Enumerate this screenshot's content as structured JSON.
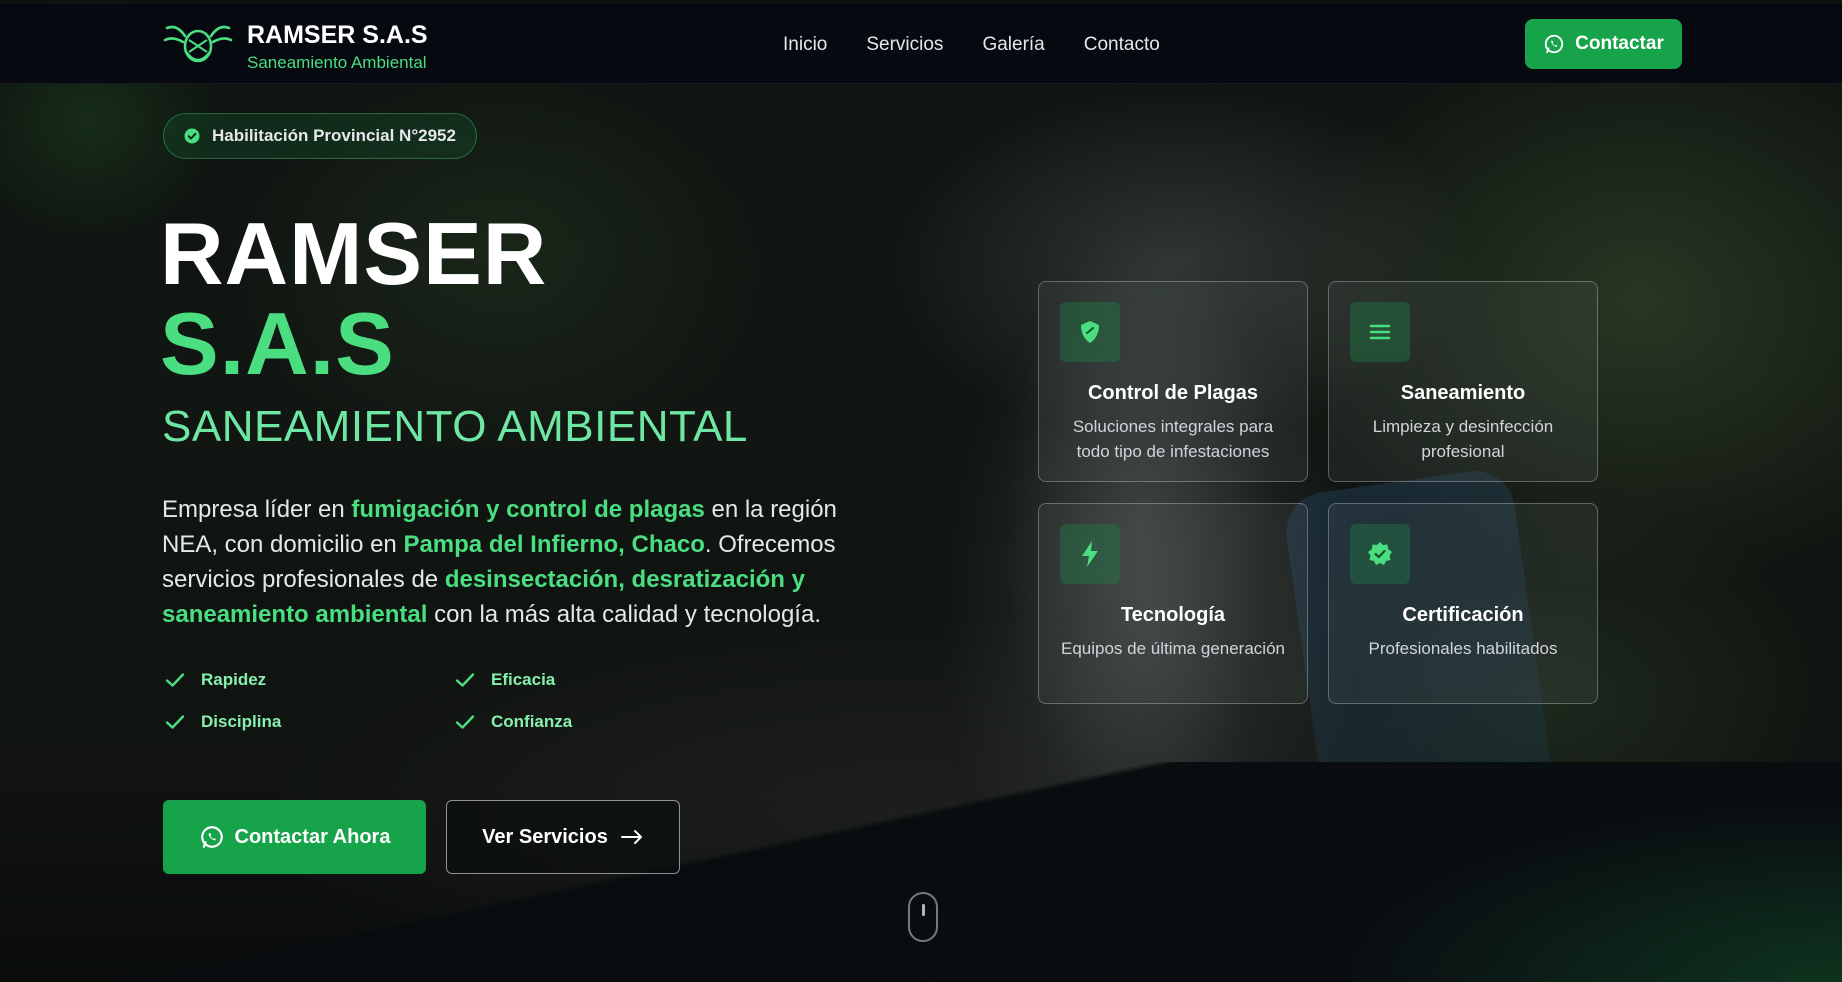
{
  "nav": {
    "brand_name": "RAMSER S.A.S",
    "brand_sub": "Saneamiento Ambiental",
    "links": [
      "Inicio",
      "Servicios",
      "Galería",
      "Contacto"
    ],
    "cta_label": "Contactar",
    "cta_icon": "whatsapp-icon"
  },
  "hero": {
    "badge": "Habilitación Provincial N°2952",
    "title_line1": "RAMSER",
    "title_line2": "S.A.S",
    "subtitle": "SANEAMIENTO AMBIENTAL",
    "desc": {
      "p1": "Empresa líder en ",
      "h1": "fumigación y control de plagas",
      "p2": " en la región NEA, con domicilio en ",
      "h2": "Pampa del Infierno, Chaco",
      "p3": ". Ofrecemos servicios profesionales de ",
      "h3": "desinsectación, desratización y saneamiento ambiental",
      "p4": " con la más alta calidad y tecnología."
    },
    "features": [
      "Rapidez",
      "Eficacia",
      "Disciplina",
      "Confianza"
    ],
    "primary_button": "Contactar Ahora",
    "secondary_button": "Ver Servicios"
  },
  "cards": [
    {
      "title": "Control de Plagas",
      "desc": "Soluciones integrales para todo tipo de infestaciones",
      "icon": "shield-check-icon"
    },
    {
      "title": "Saneamiento",
      "desc": "Limpieza y desinfección profesional",
      "icon": "menu-lines-icon"
    },
    {
      "title": "Tecnología",
      "desc": "Equipos de última generación",
      "icon": "lightning-icon"
    },
    {
      "title": "Certificación",
      "desc": "Profesionales habilitados",
      "icon": "badge-check-icon"
    }
  ],
  "colors": {
    "accent": "#4ade80",
    "button": "#16a34a",
    "nav_bg": "#06090f"
  }
}
